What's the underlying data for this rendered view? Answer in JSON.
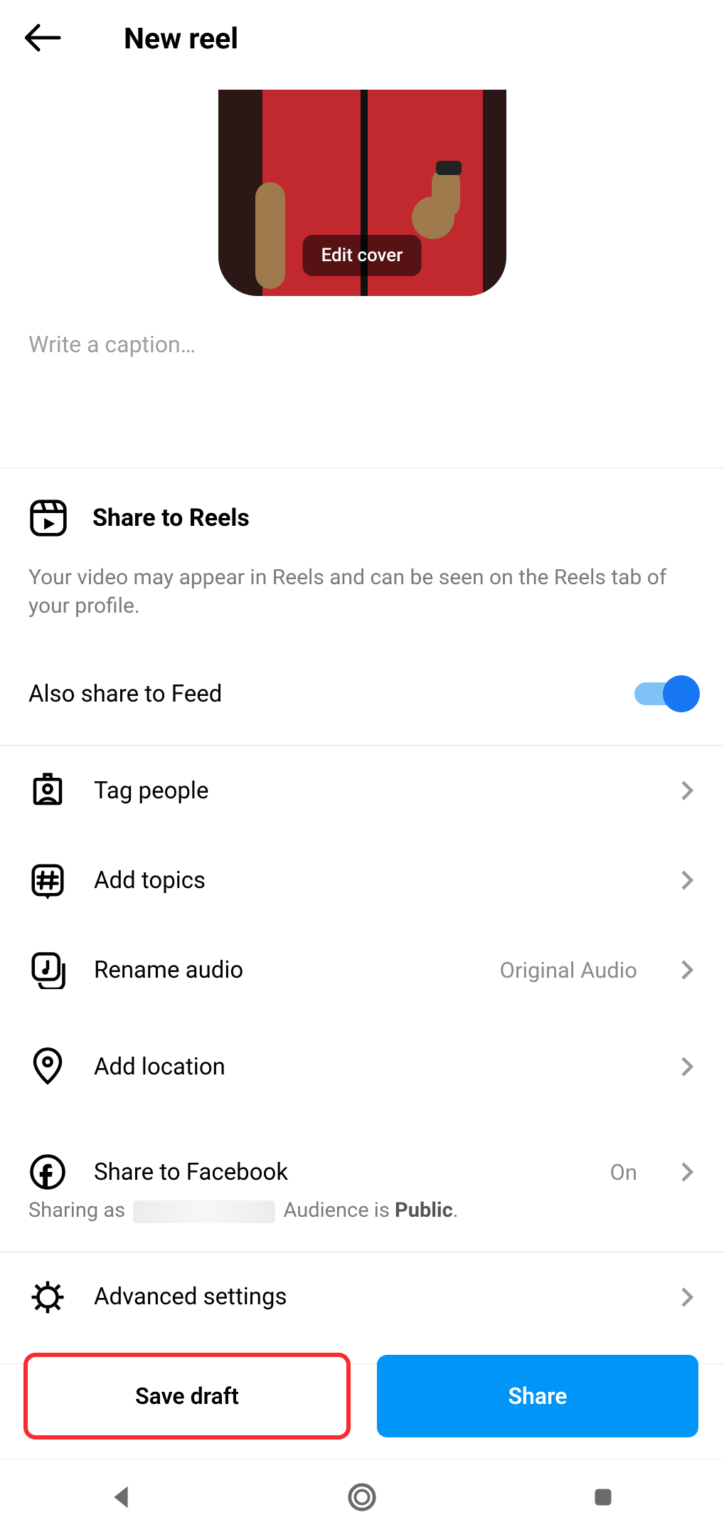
{
  "header": {
    "title": "New reel"
  },
  "cover": {
    "edit_label": "Edit cover"
  },
  "caption": {
    "placeholder": "Write a caption…",
    "value": ""
  },
  "share_reels": {
    "title": "Share to Reels",
    "description": "Your video may appear in Reels and can be seen on the Reels tab of your profile."
  },
  "feed": {
    "label": "Also share to Feed",
    "enabled": true
  },
  "options": {
    "tag_people": {
      "label": "Tag people"
    },
    "add_topics": {
      "label": "Add topics"
    },
    "rename_audio": {
      "label": "Rename audio",
      "value": "Original Audio"
    },
    "add_location": {
      "label": "Add location"
    },
    "share_facebook": {
      "label": "Share to Facebook",
      "value": "On",
      "sub_prefix": "Sharing as",
      "sub_audience_prefix": "Audience is ",
      "sub_audience_value": "Public",
      "sub_suffix": "."
    },
    "advanced": {
      "label": "Advanced settings"
    }
  },
  "buttons": {
    "save_draft": "Save draft",
    "share": "Share"
  }
}
